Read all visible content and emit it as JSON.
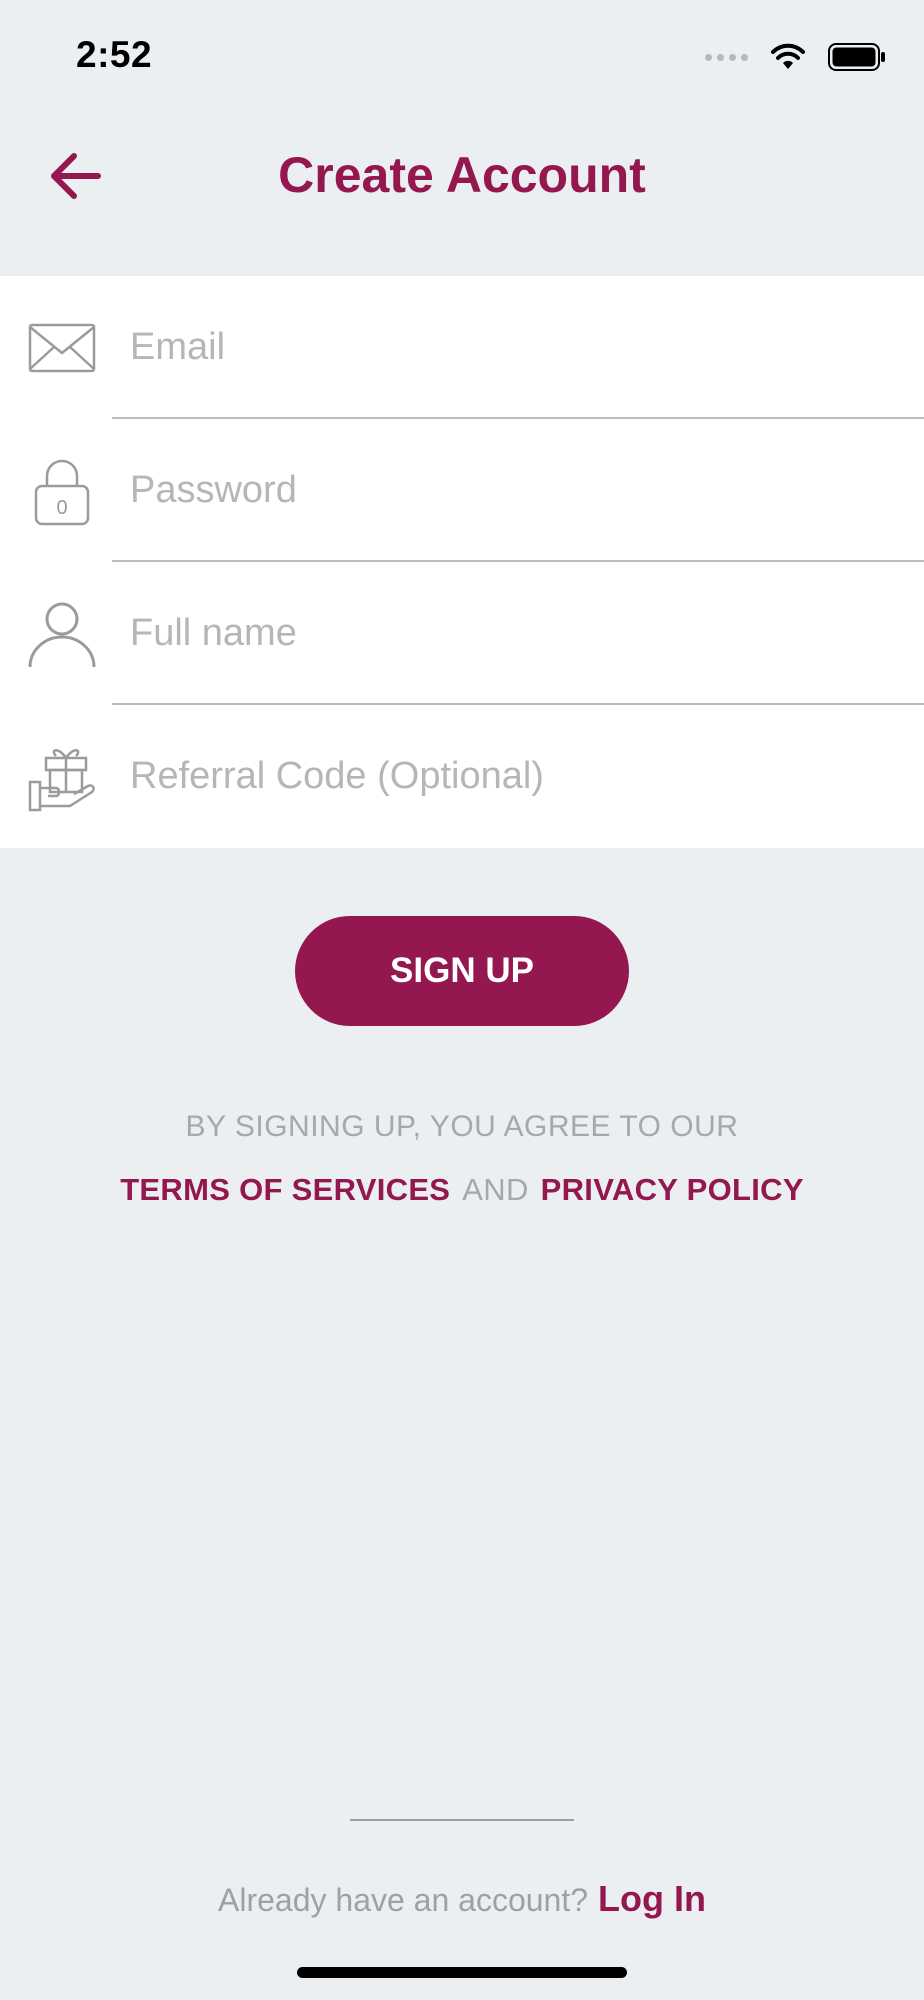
{
  "status_bar": {
    "time": "2:52",
    "icons": [
      "cellular-signal-icon",
      "wifi-icon",
      "battery-icon"
    ]
  },
  "header": {
    "title": "Create Account",
    "back_icon": "arrow-left-icon"
  },
  "form": {
    "fields": [
      {
        "icon": "envelope-icon",
        "placeholder": "Email",
        "value": ""
      },
      {
        "icon": "lock-icon",
        "placeholder": "Password",
        "value": ""
      },
      {
        "icon": "user-icon",
        "placeholder": "Full name",
        "value": ""
      },
      {
        "icon": "gift-hand-icon",
        "placeholder": "Referral Code (Optional)",
        "value": ""
      }
    ]
  },
  "signup_button": {
    "label": "SIGN UP"
  },
  "terms": {
    "intro": "BY SIGNING UP, YOU AGREE TO OUR",
    "terms_link": "TERMS OF SERVICES",
    "and": "AND",
    "privacy_link": "PRIVACY POLICY"
  },
  "footer": {
    "prompt": "Already have an account?",
    "login_link": "Log In"
  },
  "colors": {
    "accent": "#95174f",
    "background": "#ebeff2",
    "placeholder": "#b6b6b6",
    "muted_text": "#a8a8a8"
  }
}
